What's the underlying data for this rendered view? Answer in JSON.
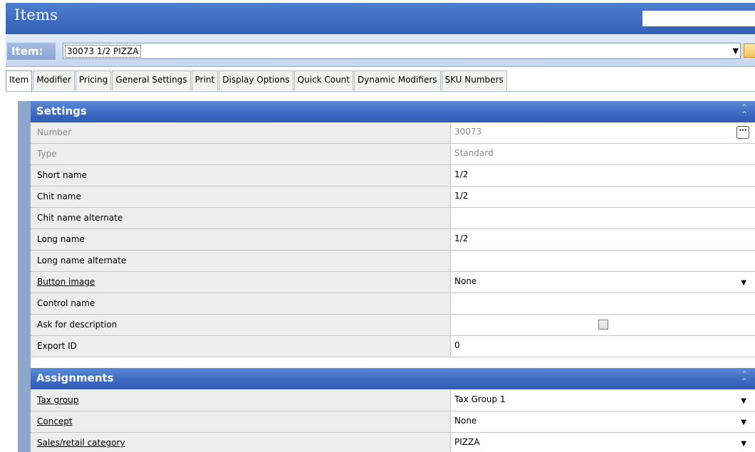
{
  "window": {
    "title": "Items"
  },
  "item_selector": {
    "label": "Item:",
    "value": "30073 1/2 PIZZA",
    "arrow_icon": "chevron-down-icon",
    "grid_icon": "grid-icon"
  },
  "tabs": [
    {
      "label": "Item",
      "active": true
    },
    {
      "label": "Modifier"
    },
    {
      "label": "Pricing"
    },
    {
      "label": "General Settings"
    },
    {
      "label": "Print"
    },
    {
      "label": "Display Options"
    },
    {
      "label": "Quick Count"
    },
    {
      "label": "Dynamic Modifiers"
    },
    {
      "label": "SKU Numbers"
    }
  ],
  "settings": {
    "title": "Settings",
    "collapse_icon": "double-chevron-up-icon",
    "rows": [
      {
        "name": "Number",
        "value": "30073"
      },
      {
        "name": "Type",
        "value": "Standard"
      },
      {
        "name": "Short name",
        "value": "1/2"
      },
      {
        "name": "Chit name",
        "value": "1/2"
      },
      {
        "name": "Chit name alternate",
        "value": ""
      },
      {
        "name": "Long name",
        "value": "1/2"
      },
      {
        "name": "Long name alternate",
        "value": ""
      },
      {
        "name": "Button image",
        "value": "None"
      },
      {
        "name": "Control name",
        "value": ""
      },
      {
        "name": "Ask for description",
        "value": "",
        "checked": false
      },
      {
        "name": "Export ID",
        "value": "0"
      }
    ]
  },
  "assignments": {
    "title": "Assignments",
    "collapse_icon": "double-chevron-up-icon",
    "rows": [
      {
        "name": "Tax group",
        "value": "Tax Group 1"
      },
      {
        "name": "Concept",
        "value": "None"
      },
      {
        "name": "Sales/retail category",
        "value": "PIZZA"
      }
    ]
  },
  "colors": {
    "header_blue": "#3c6bc0",
    "section_blue": "#3e6cc3",
    "row_label_bg": "#ededed"
  }
}
